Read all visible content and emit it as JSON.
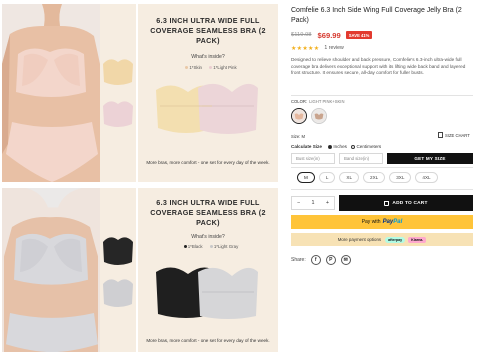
{
  "gallery": [
    {
      "promo_title": "6.3 INCH ULTRA WIDE FULL COVERAGE SEAMLESS BRA (2 PACK)",
      "promo_sub": "What's inside?",
      "colors": [
        {
          "label": "1*Skin",
          "color": "#e9c8a6"
        },
        {
          "label": "1*Light Pink",
          "color": "#e9cdd0"
        }
      ],
      "foot": "More bras, more comfort - one set for every day of the week."
    },
    {
      "promo_title": "6.3 INCH ULTRA WIDE FULL COVERAGE SEAMLESS BRA (2 PACK)",
      "promo_sub": "What's inside?",
      "colors": [
        {
          "label": "1*Black",
          "color": "#222222"
        },
        {
          "label": "1*Light Gray",
          "color": "#c8c8c8"
        }
      ],
      "foot": "More bras, more comfort - one set for every day of the week."
    }
  ],
  "product": {
    "title": "Comfelie 6.3 Inch Side Wing Full Coverage Jelly Bra (2 Pack)",
    "old_price": "$119.98",
    "new_price": "$69.99",
    "save_badge": "SAVE 41%",
    "stars": "★★★★★",
    "reviews": "1 review",
    "description": "Designed to relieve shoulder and back pressure, Comfelie's 6.3-inch ultra-wide full coverage bra delivers exceptional support with its lifting wide back band and layered front structure. It ensures secure, all-day comfort for fuller busts.",
    "color_label": "COLOR:",
    "color_value": "LIGHT PINK+SKIN",
    "size_label": "Size: M",
    "size_chart": "SIZE CHART",
    "calc_label": "Calculate Size",
    "unit_inches": "Inches",
    "unit_cm": "Centimeters",
    "bust_placeholder": "Bust size(in)",
    "band_placeholder": "Band size(in)",
    "get_size": "GET MY SIZE",
    "sizes": [
      "M",
      "L",
      "XL",
      "2XL",
      "3XL",
      "4XL"
    ],
    "selected_size": "M",
    "qty": "1",
    "qty_minus": "−",
    "qty_plus": "+",
    "add_to_cart": "ADD TO CART",
    "pay_with": "Pay with",
    "paypal_pay": "Pay",
    "paypal_pal": "Pal",
    "more_payment": "More payment options",
    "afterpay": "afterpay",
    "klarna": "Klarna.",
    "share": "Share:",
    "share_icons": [
      "f",
      "P",
      "✉"
    ]
  },
  "colors": {
    "price_red": "#d63a2f",
    "paypal_yellow": "#ffc439",
    "promo_bg": "#f6ede1",
    "button_dark": "#111111"
  }
}
